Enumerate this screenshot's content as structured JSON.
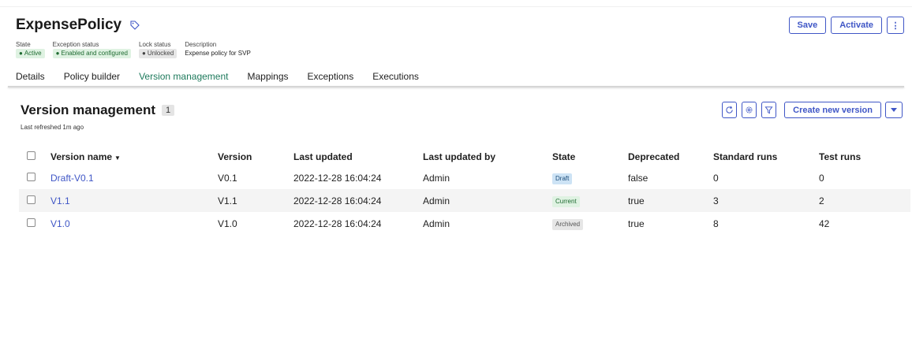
{
  "header": {
    "title": "ExpensePolicy",
    "meta": [
      {
        "label": "State",
        "value": "Active",
        "style": "green"
      },
      {
        "label": "Exception status",
        "value": "Enabled and configured",
        "style": "green"
      },
      {
        "label": "Lock status",
        "value": "Unlocked",
        "style": "gray"
      },
      {
        "label": "Description",
        "value": "Expense policy for SVP",
        "style": "text"
      }
    ],
    "actions": {
      "save": "Save",
      "activate": "Activate",
      "more": "⋮"
    }
  },
  "tabs": [
    {
      "label": "Details",
      "active": false
    },
    {
      "label": "Policy builder",
      "active": false
    },
    {
      "label": "Version management",
      "active": true
    },
    {
      "label": "Mappings",
      "active": false
    },
    {
      "label": "Exceptions",
      "active": false
    },
    {
      "label": "Executions",
      "active": false
    }
  ],
  "section": {
    "title": "Version management",
    "count": "1",
    "last_refreshed": "Last refreshed 1m ago",
    "create_label": "Create new version"
  },
  "table": {
    "columns": [
      "Version name",
      "Version",
      "Last updated",
      "Last updated by",
      "State",
      "Deprecated",
      "Standard runs",
      "Test runs"
    ],
    "rows": [
      {
        "name": "Draft-V0.1",
        "version": "V0.1",
        "updated": "2022-12-28 16:04:24",
        "by": "Admin",
        "state": "Draft",
        "state_style": "draft",
        "deprecated": "false",
        "standard_runs": "0",
        "test_runs": "0"
      },
      {
        "name": "V1.1",
        "version": "V1.1",
        "updated": "2022-12-28 16:04:24",
        "by": "Admin",
        "state": "Current",
        "state_style": "current",
        "deprecated": "true",
        "standard_runs": "3",
        "test_runs": "2"
      },
      {
        "name": "V1.0",
        "version": "V1.0",
        "updated": "2022-12-28 16:04:24",
        "by": "Admin",
        "state": "Archived",
        "state_style": "archived",
        "deprecated": "true",
        "standard_runs": "8",
        "test_runs": "42"
      }
    ]
  },
  "colors": {
    "accent": "#3f56c6",
    "tab_active": "#1e7a5c"
  },
  "icons": [
    "tag-icon",
    "refresh-icon",
    "settings-icon",
    "filter-icon",
    "caret-down-icon",
    "sort-down-icon"
  ]
}
